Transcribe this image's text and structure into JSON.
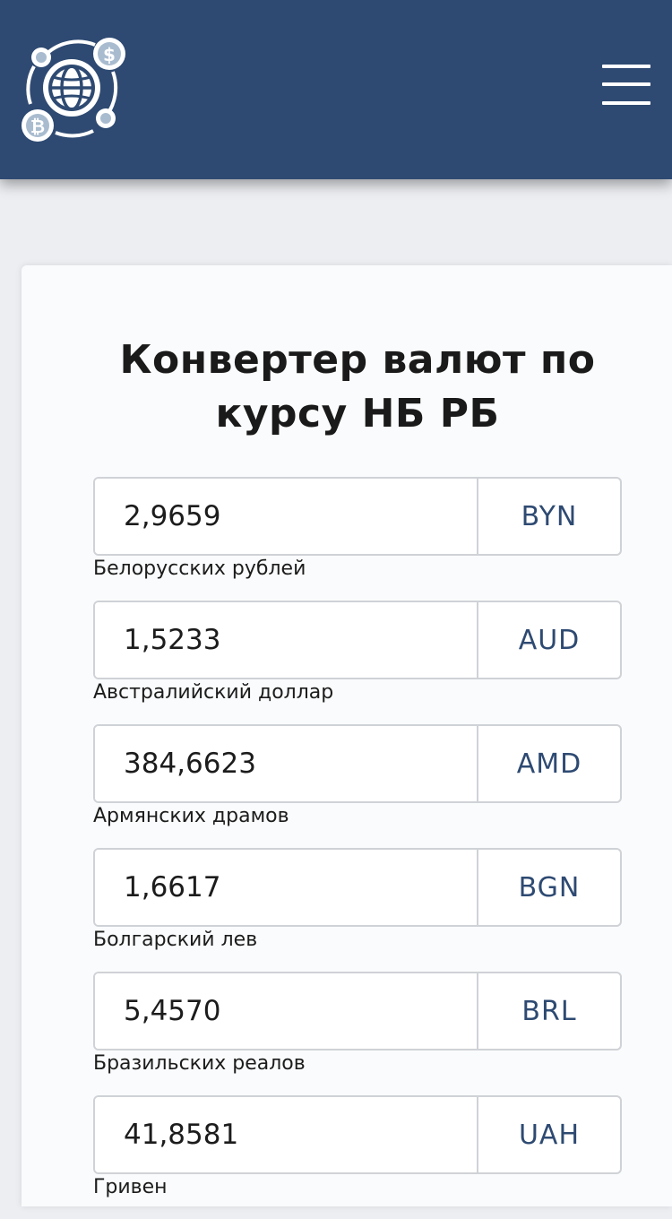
{
  "header": {
    "logo_icon": "globe-currency-exchange-icon",
    "menu_icon": "hamburger-menu-icon",
    "background": "#2e4a72"
  },
  "main": {
    "title": "Конвертер валют по курсу НБ РБ",
    "currencies": [
      {
        "value": "2,9659",
        "code": "BYN",
        "name": "Белорусских рублей"
      },
      {
        "value": "1,5233",
        "code": "AUD",
        "name": "Австралийский доллар"
      },
      {
        "value": "384,6623",
        "code": "AMD",
        "name": "Армянских драмов"
      },
      {
        "value": "1,6617",
        "code": "BGN",
        "name": "Болгарский лев"
      },
      {
        "value": "5,4570",
        "code": "BRL",
        "name": "Бразильских реалов"
      },
      {
        "value": "41,8581",
        "code": "UAH",
        "name": "Гривен"
      }
    ]
  }
}
